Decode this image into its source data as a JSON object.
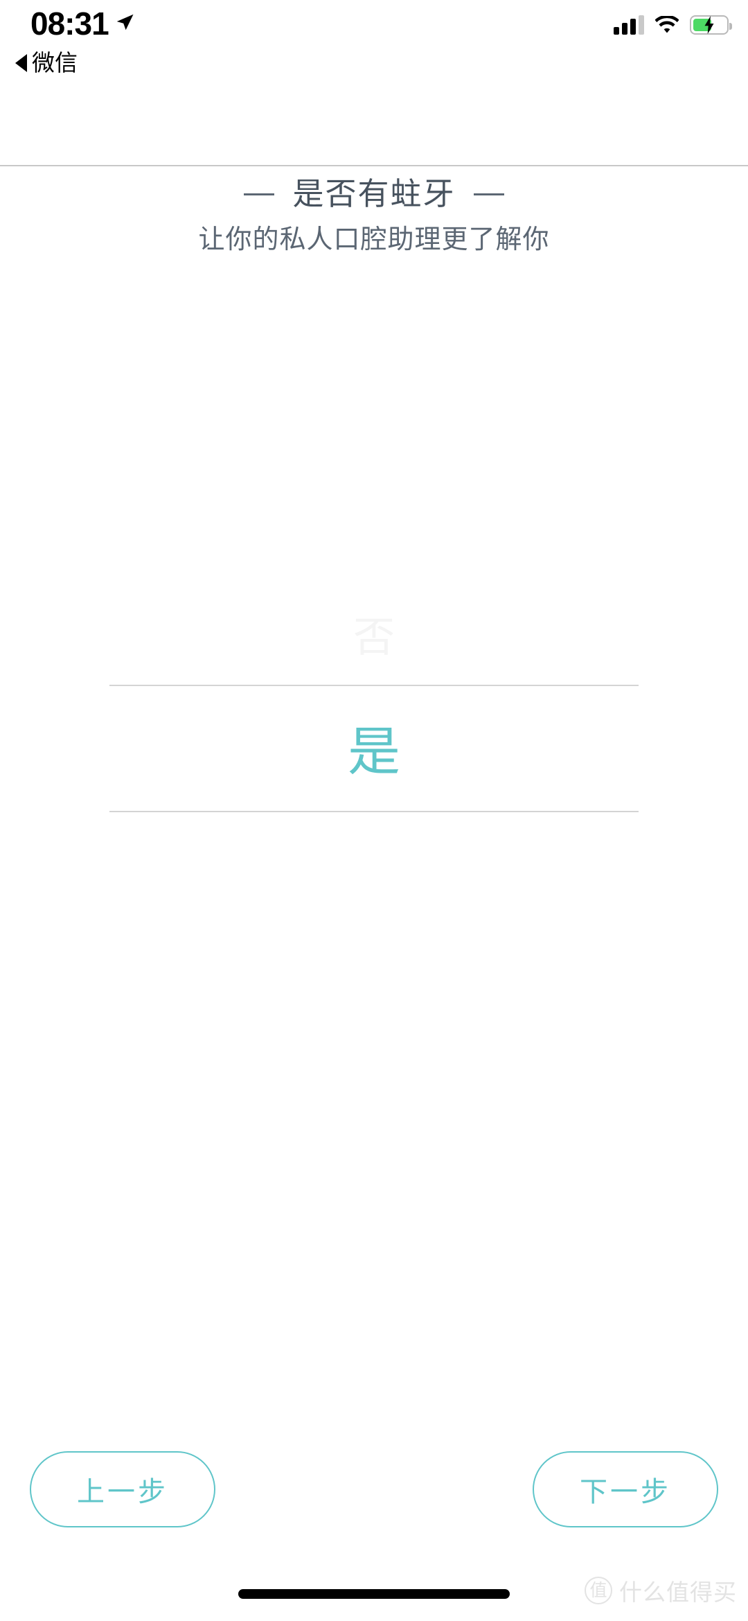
{
  "status_bar": {
    "time": "08:31",
    "location_icon": "location-arrow-icon",
    "signal_icon": "cellular-signal-icon",
    "wifi_icon": "wifi-icon",
    "battery_icon": "battery-charging-icon"
  },
  "back_nav": {
    "icon": "back-triangle-icon",
    "label": "微信"
  },
  "question": {
    "title": "是否有蛀牙",
    "subtitle": "让你的私人口腔助理更了解你",
    "left_dash": "",
    "right_dash": ""
  },
  "picker": {
    "options": [
      "否",
      "是"
    ],
    "previous_visible_option": "否",
    "selected_option": "是",
    "selected_index": 1,
    "accent_color": "#5fc5c9",
    "dim_color": "#f4f4f4",
    "line_color": "#d4d4d4"
  },
  "buttons": {
    "previous": "上一步",
    "next": "下一步",
    "accent_color": "#5fc5c9"
  },
  "watermark": {
    "logo_glyph": "值",
    "text": "什么值得买"
  },
  "home_indicator": {
    "label": "home-indicator"
  }
}
